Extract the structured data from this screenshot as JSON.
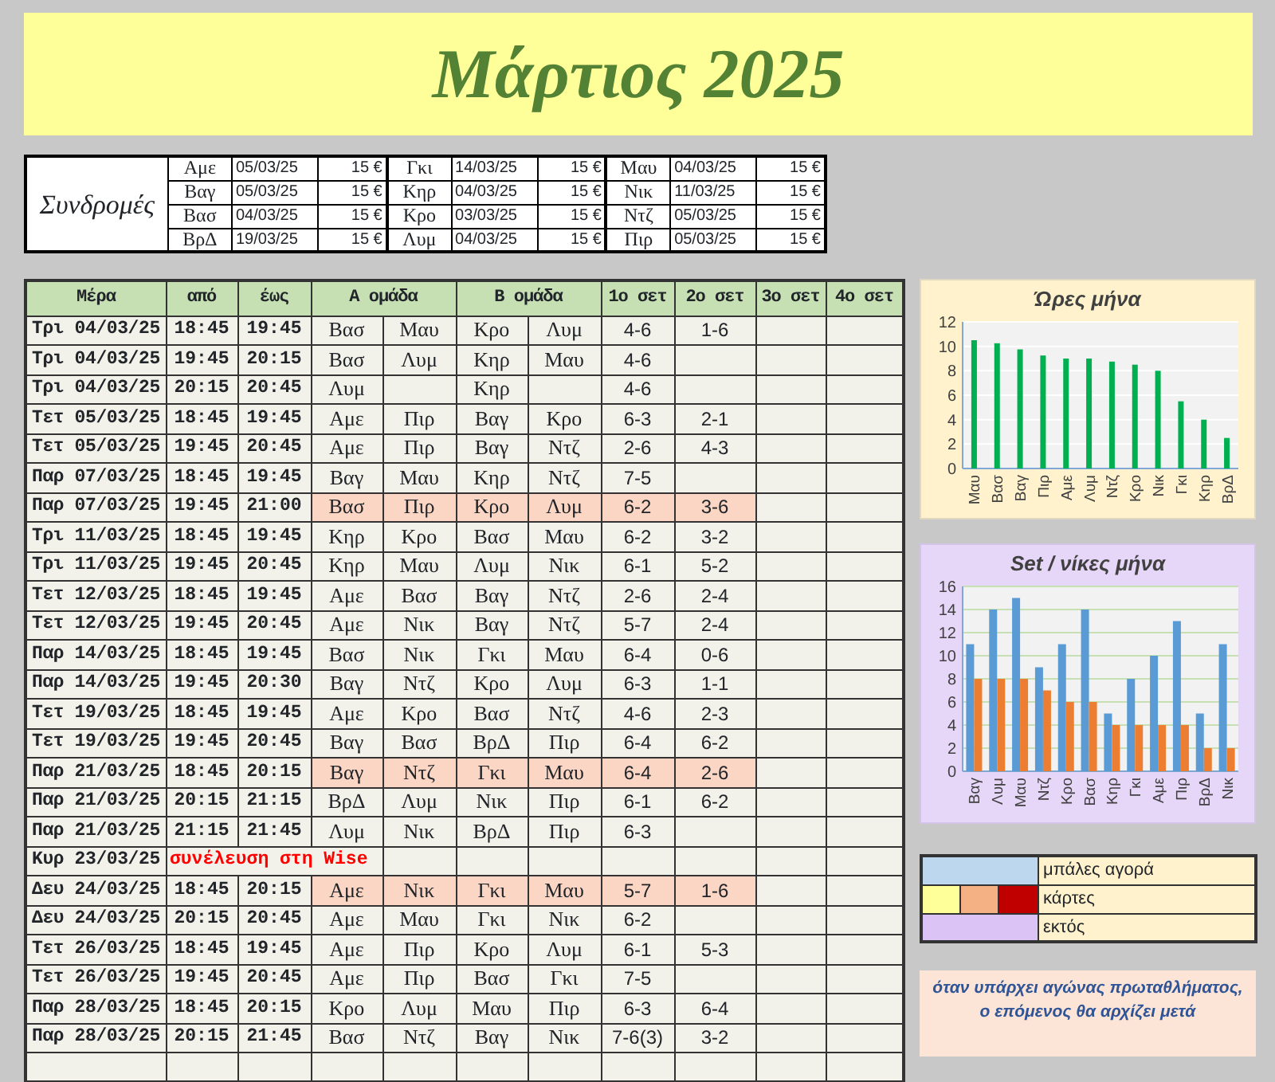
{
  "title": "Μάρτιος 2025",
  "subscriptions": {
    "title": "Συνδρομές",
    "groups": [
      [
        {
          "name": "Αμε",
          "date": "05/03/25",
          "amount": "15 €"
        },
        {
          "name": "Βαγ",
          "date": "05/03/25",
          "amount": "15 €"
        },
        {
          "name": "Βασ",
          "date": "04/03/25",
          "amount": "15 €"
        },
        {
          "name": "ΒρΔ",
          "date": "19/03/25",
          "amount": "15 €"
        }
      ],
      [
        {
          "name": "Γκι",
          "date": "14/03/25",
          "amount": "15 €"
        },
        {
          "name": "Κηρ",
          "date": "04/03/25",
          "amount": "15 €"
        },
        {
          "name": "Κρο",
          "date": "03/03/25",
          "amount": "15 €"
        },
        {
          "name": "Λυμ",
          "date": "04/03/25",
          "amount": "15 €"
        }
      ],
      [
        {
          "name": "Μαυ",
          "date": "04/03/25",
          "amount": "15 €"
        },
        {
          "name": "Νικ",
          "date": "11/03/25",
          "amount": "15 €"
        },
        {
          "name": "Ντζ",
          "date": "05/03/25",
          "amount": "15 €"
        },
        {
          "name": "Πιρ",
          "date": "05/03/25",
          "amount": "15 €"
        }
      ]
    ]
  },
  "schedule": {
    "columns": [
      "Μέρα",
      "από",
      "έως",
      "Α ομάδα",
      "Β ομάδα",
      "1ο σετ",
      "2ο σετ",
      "3ο σετ",
      "4ο σετ"
    ],
    "rows": [
      {
        "kind": "match",
        "day": "Τρι 04/03/25",
        "from": "18:45",
        "to": "19:45",
        "team_a": [
          "Βασ",
          "Μαυ"
        ],
        "team_b": [
          "Κρο",
          "Λυμ"
        ],
        "sets": [
          "4-6",
          "1-6"
        ],
        "highlighted": false
      },
      {
        "kind": "match",
        "day": "Τρι 04/03/25",
        "from": "19:45",
        "to": "20:15",
        "team_a": [
          "Βασ",
          "Λυμ"
        ],
        "team_b": [
          "Κηρ",
          "Μαυ"
        ],
        "sets": [
          "4-6"
        ],
        "highlighted": false
      },
      {
        "kind": "match",
        "day": "Τρι 04/03/25",
        "from": "20:15",
        "to": "20:45",
        "team_a": [
          "Λυμ"
        ],
        "team_b": [
          "Κηρ"
        ],
        "sets": [
          "4-6"
        ],
        "highlighted": false
      },
      {
        "kind": "match",
        "day": "Τετ 05/03/25",
        "from": "18:45",
        "to": "19:45",
        "team_a": [
          "Αμε",
          "Πιρ"
        ],
        "team_b": [
          "Βαγ",
          "Κρο"
        ],
        "sets": [
          "6-3",
          "2-1"
        ],
        "highlighted": false
      },
      {
        "kind": "match",
        "day": "Τετ 05/03/25",
        "from": "19:45",
        "to": "20:45",
        "team_a": [
          "Αμε",
          "Πιρ"
        ],
        "team_b": [
          "Βαγ",
          "Ντζ"
        ],
        "sets": [
          "2-6",
          "4-3"
        ],
        "highlighted": false
      },
      {
        "kind": "match",
        "day": "Παρ 07/03/25",
        "from": "18:45",
        "to": "19:45",
        "team_a": [
          "Βαγ",
          "Μαυ"
        ],
        "team_b": [
          "Κηρ",
          "Ντζ"
        ],
        "sets": [
          "7-5"
        ],
        "highlighted": false
      },
      {
        "kind": "match",
        "day": "Παρ 07/03/25",
        "from": "19:45",
        "to": "21:00",
        "team_a": [
          "Βασ",
          "Πιρ"
        ],
        "team_b": [
          "Κρο",
          "Λυμ"
        ],
        "sets": [
          "6-2",
          "3-6"
        ],
        "highlighted": true
      },
      {
        "kind": "match",
        "day": "Τρι 11/03/25",
        "from": "18:45",
        "to": "19:45",
        "team_a": [
          "Κηρ",
          "Κρο"
        ],
        "team_b": [
          "Βασ",
          "Μαυ"
        ],
        "sets": [
          "6-2",
          "3-2"
        ],
        "highlighted": false
      },
      {
        "kind": "match",
        "day": "Τρι 11/03/25",
        "from": "19:45",
        "to": "20:45",
        "team_a": [
          "Κηρ",
          "Μαυ"
        ],
        "team_b": [
          "Λυμ",
          "Νικ"
        ],
        "sets": [
          "6-1",
          "5-2"
        ],
        "highlighted": false
      },
      {
        "kind": "match",
        "day": "Τετ 12/03/25",
        "from": "18:45",
        "to": "19:45",
        "team_a": [
          "Αμε",
          "Βασ"
        ],
        "team_b": [
          "Βαγ",
          "Ντζ"
        ],
        "sets": [
          "2-6",
          "2-4"
        ],
        "highlighted": false
      },
      {
        "kind": "match",
        "day": "Τετ 12/03/25",
        "from": "19:45",
        "to": "20:45",
        "team_a": [
          "Αμε",
          "Νικ"
        ],
        "team_b": [
          "Βαγ",
          "Ντζ"
        ],
        "sets": [
          "5-7",
          "2-4"
        ],
        "highlighted": false
      },
      {
        "kind": "match",
        "day": "Παρ 14/03/25",
        "from": "18:45",
        "to": "19:45",
        "team_a": [
          "Βασ",
          "Νικ"
        ],
        "team_b": [
          "Γκι",
          "Μαυ"
        ],
        "sets": [
          "6-4",
          "0-6"
        ],
        "highlighted": false
      },
      {
        "kind": "match",
        "day": "Παρ 14/03/25",
        "from": "19:45",
        "to": "20:30",
        "team_a": [
          "Βαγ",
          "Ντζ"
        ],
        "team_b": [
          "Κρο",
          "Λυμ"
        ],
        "sets": [
          "6-3",
          "1-1"
        ],
        "highlighted": false
      },
      {
        "kind": "match",
        "day": "Τετ 19/03/25",
        "from": "18:45",
        "to": "19:45",
        "team_a": [
          "Αμε",
          "Κρο"
        ],
        "team_b": [
          "Βασ",
          "Ντζ"
        ],
        "sets": [
          "4-6",
          "2-3"
        ],
        "highlighted": false
      },
      {
        "kind": "match",
        "day": "Τετ 19/03/25",
        "from": "19:45",
        "to": "20:45",
        "team_a": [
          "Βαγ",
          "Βασ"
        ],
        "team_b": [
          "ΒρΔ",
          "Πιρ"
        ],
        "sets": [
          "6-4",
          "6-2"
        ],
        "highlighted": false
      },
      {
        "kind": "match",
        "day": "Παρ 21/03/25",
        "from": "18:45",
        "to": "20:15",
        "team_a": [
          "Βαγ",
          "Ντζ"
        ],
        "team_b": [
          "Γκι",
          "Μαυ"
        ],
        "sets": [
          "6-4",
          "2-6"
        ],
        "highlighted": true
      },
      {
        "kind": "match",
        "day": "Παρ 21/03/25",
        "from": "20:15",
        "to": "21:15",
        "team_a": [
          "ΒρΔ",
          "Λυμ"
        ],
        "team_b": [
          "Νικ",
          "Πιρ"
        ],
        "sets": [
          "6-1",
          "6-2"
        ],
        "highlighted": false
      },
      {
        "kind": "match",
        "day": "Παρ 21/03/25",
        "from": "21:15",
        "to": "21:45",
        "team_a": [
          "Λυμ",
          "Νικ"
        ],
        "team_b": [
          "ΒρΔ",
          "Πιρ"
        ],
        "sets": [
          "6-3"
        ],
        "highlighted": false
      },
      {
        "kind": "note",
        "day": "Κυρ 23/03/25",
        "note": "συνέλευση στη Wise"
      },
      {
        "kind": "match",
        "day": "Δευ 24/03/25",
        "from": "18:45",
        "to": "20:15",
        "team_a": [
          "Αμε",
          "Νικ"
        ],
        "team_b": [
          "Γκι",
          "Μαυ"
        ],
        "sets": [
          "5-7",
          "1-6"
        ],
        "highlighted": true
      },
      {
        "kind": "match",
        "day": "Δευ 24/03/25",
        "from": "20:15",
        "to": "20:45",
        "team_a": [
          "Αμε",
          "Μαυ"
        ],
        "team_b": [
          "Γκι",
          "Νικ"
        ],
        "sets": [
          "6-2"
        ],
        "highlighted": false
      },
      {
        "kind": "match",
        "day": "Τετ 26/03/25",
        "from": "18:45",
        "to": "19:45",
        "team_a": [
          "Αμε",
          "Πιρ"
        ],
        "team_b": [
          "Κρο",
          "Λυμ"
        ],
        "sets": [
          "6-1",
          "5-3"
        ],
        "highlighted": false
      },
      {
        "kind": "match",
        "day": "Τετ 26/03/25",
        "from": "19:45",
        "to": "20:45",
        "team_a": [
          "Αμε",
          "Πιρ"
        ],
        "team_b": [
          "Βασ",
          "Γκι"
        ],
        "sets": [
          "7-5"
        ],
        "highlighted": false
      },
      {
        "kind": "match",
        "day": "Παρ 28/03/25",
        "from": "18:45",
        "to": "20:15",
        "team_a": [
          "Κρο",
          "Λυμ"
        ],
        "team_b": [
          "Μαυ",
          "Πιρ"
        ],
        "sets": [
          "6-3",
          "6-4"
        ],
        "highlighted": false
      },
      {
        "kind": "match",
        "day": "Παρ 28/03/25",
        "from": "20:15",
        "to": "21:45",
        "team_a": [
          "Βασ",
          "Ντζ"
        ],
        "team_b": [
          "Βαγ",
          "Νικ"
        ],
        "sets": [
          "7-6(3)",
          "3-2"
        ],
        "highlighted": false
      }
    ]
  },
  "hours_chart": {
    "chart_data": {
      "type": "bar",
      "title": "Ώρες μήνα",
      "categories": [
        "Μαυ",
        "Βασ",
        "Βαγ",
        "Πιρ",
        "Αμε",
        "Λυμ",
        "Ντζ",
        "Κρο",
        "Νικ",
        "Γκι",
        "Κηρ",
        "ΒρΔ"
      ],
      "series": [
        {
          "color": "#00b050",
          "values": [
            10.5,
            10.25,
            9.75,
            9.25,
            9,
            9,
            8.75,
            8.5,
            8,
            5.5,
            4,
            2.5
          ]
        }
      ],
      "ylim": [
        0,
        12
      ],
      "yticks": [
        0,
        2,
        4,
        6,
        8,
        10,
        12
      ],
      "grid": true
    }
  },
  "sets_chart": {
    "chart_data": {
      "type": "bar",
      "title": "Set / νίκες μήνα",
      "categories": [
        "Βαγ",
        "Λυμ",
        "Μαυ",
        "Ντζ",
        "Κρο",
        "Βασ",
        "Κηρ",
        "Γκι",
        "Αμε",
        "Πιρ",
        "ΒρΔ",
        "Νικ"
      ],
      "series": [
        {
          "color": "#5b9bd5",
          "values": [
            11,
            14,
            15,
            9,
            11,
            14,
            5,
            8,
            10,
            13,
            5,
            11
          ]
        },
        {
          "color": "#ed7d31",
          "values": [
            8,
            8,
            8,
            7,
            6,
            6,
            4,
            4,
            4,
            4,
            2,
            2
          ]
        }
      ],
      "ylim": [
        0,
        16
      ],
      "yticks": [
        0,
        2,
        4,
        6,
        8,
        10,
        12,
        14,
        16
      ],
      "grid": true
    }
  },
  "legend": [
    {
      "label": "μπάλες αγορά",
      "swatches": [
        {
          "color": "#bdd7ee"
        }
      ]
    },
    {
      "label": "κάρτες",
      "swatches": [
        {
          "color": "#ffff99"
        },
        {
          "color": "#f4b183"
        },
        {
          "color": "#c00000"
        }
      ]
    },
    {
      "label": "εκτός",
      "swatches": [
        {
          "color": "#dcc3f5"
        }
      ]
    }
  ],
  "note": "όταν υπάρχει αγώνας πρωταθλήματος, ο επόμενος θα αρχίζει μετά"
}
